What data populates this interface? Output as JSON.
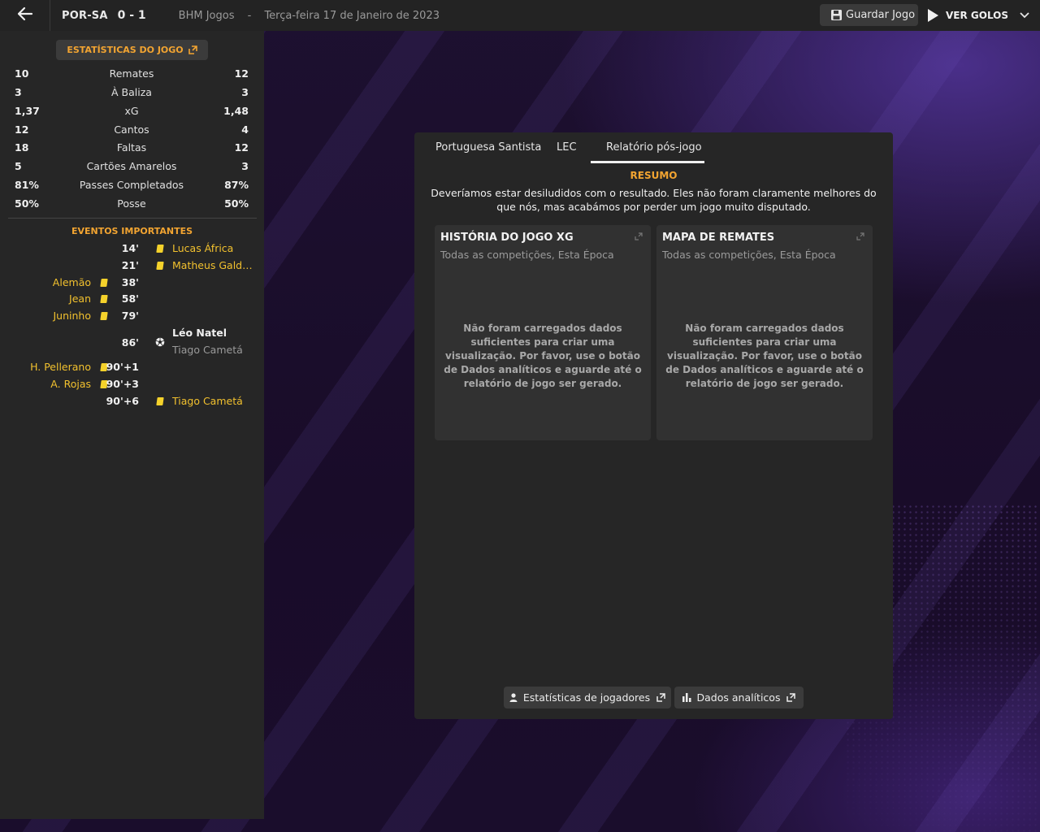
{
  "topbar": {
    "teams": "POR-SA",
    "score": "0 - 1",
    "competition": "BHM Jogos",
    "separator": "-",
    "date": "Terça-feira 17 de Janeiro de 2023",
    "save_label": "Guardar Jogo",
    "goals_label": "VER GOLOS"
  },
  "stats": {
    "header": "ESTATÍSTICAS DO JOGO",
    "rows": [
      {
        "home": "10",
        "label": "Remates",
        "away": "12"
      },
      {
        "home": "3",
        "label": "À Baliza",
        "away": "3"
      },
      {
        "home": "1,37",
        "label": "xG",
        "away": "1,48"
      },
      {
        "home": "12",
        "label": "Cantos",
        "away": "4"
      },
      {
        "home": "18",
        "label": "Faltas",
        "away": "12"
      },
      {
        "home": "5",
        "label": "Cartões Amarelos",
        "away": "3"
      },
      {
        "home": "81%",
        "label": "Passes Completados",
        "away": "87%"
      },
      {
        "home": "50%",
        "label": "Posse",
        "away": "50%"
      }
    ]
  },
  "events": {
    "title": "EVENTOS IMPORTANTES",
    "items": [
      {
        "minute": "14'",
        "away": "Lucas África",
        "type": "yellow-card"
      },
      {
        "minute": "21'",
        "away": "Matheus Galdez...",
        "type": "yellow-card"
      },
      {
        "minute": "38'",
        "home": "Alemão",
        "type": "yellow-card"
      },
      {
        "minute": "58'",
        "home": "Jean",
        "type": "yellow-card"
      },
      {
        "minute": "79'",
        "home": "Juninho",
        "type": "yellow-card"
      },
      {
        "minute": "86'",
        "away": "Léo Natel",
        "assist": "Tiago Cametá",
        "type": "goal"
      },
      {
        "minute": "90'+1",
        "home": "H. Pellerano",
        "type": "yellow-card"
      },
      {
        "minute": "90'+3",
        "home": "A. Rojas",
        "type": "yellow-card"
      },
      {
        "minute": "90'+6",
        "away": "Tiago Cametá",
        "type": "yellow-card"
      }
    ]
  },
  "report": {
    "tabs": [
      "Portuguesa Santista",
      "LEC",
      "Relatório pós-jogo"
    ],
    "active_tab": "Relatório pós-jogo",
    "summary_title": "RESUMO",
    "summary_text": "Deveríamos estar desiludidos com o resultado. Eles não foram claramente melhores do que nós, mas acabámos por perder um jogo muito disputado.",
    "cards": [
      {
        "title": "HISTÓRIA DO JOGO XG",
        "subtitle": "Todas as competições, Esta Época",
        "message": "Não foram carregados dados suficientes para criar uma visualização. Por favor, use o botão de Dados analíticos e aguarde até o relatório de jogo ser gerado."
      },
      {
        "title": "MAPA DE REMATES",
        "subtitle": "Todas as competições, Esta Época",
        "message": "Não foram carregados dados suficientes para criar uma visualização. Por favor, use o botão de Dados analíticos e aguarde até o relatório de jogo ser gerado."
      }
    ],
    "buttons": {
      "player_stats": "Estatísticas de jogadores",
      "analytics": "Dados analíticos"
    }
  },
  "colors": {
    "accent": "#f2a431",
    "yellow_card": "#f5d22b",
    "panel": "#262626"
  }
}
